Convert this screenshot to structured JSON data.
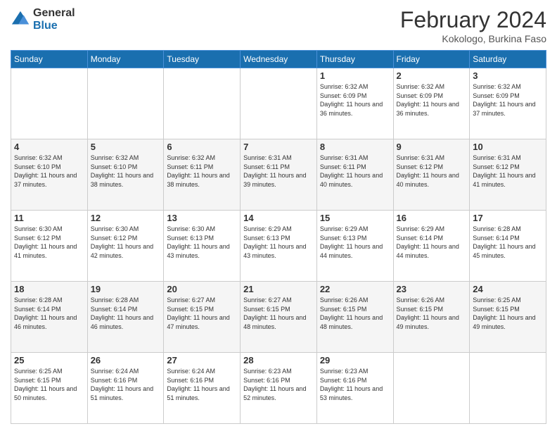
{
  "header": {
    "logo_general": "General",
    "logo_blue": "Blue",
    "month_title": "February 2024",
    "location": "Kokologo, Burkina Faso"
  },
  "weekdays": [
    "Sunday",
    "Monday",
    "Tuesday",
    "Wednesday",
    "Thursday",
    "Friday",
    "Saturday"
  ],
  "weeks": [
    [
      {
        "day": "",
        "info": ""
      },
      {
        "day": "",
        "info": ""
      },
      {
        "day": "",
        "info": ""
      },
      {
        "day": "",
        "info": ""
      },
      {
        "day": "1",
        "info": "Sunrise: 6:32 AM\nSunset: 6:09 PM\nDaylight: 11 hours and 36 minutes."
      },
      {
        "day": "2",
        "info": "Sunrise: 6:32 AM\nSunset: 6:09 PM\nDaylight: 11 hours and 36 minutes."
      },
      {
        "day": "3",
        "info": "Sunrise: 6:32 AM\nSunset: 6:09 PM\nDaylight: 11 hours and 37 minutes."
      }
    ],
    [
      {
        "day": "4",
        "info": "Sunrise: 6:32 AM\nSunset: 6:10 PM\nDaylight: 11 hours and 37 minutes."
      },
      {
        "day": "5",
        "info": "Sunrise: 6:32 AM\nSunset: 6:10 PM\nDaylight: 11 hours and 38 minutes."
      },
      {
        "day": "6",
        "info": "Sunrise: 6:32 AM\nSunset: 6:11 PM\nDaylight: 11 hours and 38 minutes."
      },
      {
        "day": "7",
        "info": "Sunrise: 6:31 AM\nSunset: 6:11 PM\nDaylight: 11 hours and 39 minutes."
      },
      {
        "day": "8",
        "info": "Sunrise: 6:31 AM\nSunset: 6:11 PM\nDaylight: 11 hours and 40 minutes."
      },
      {
        "day": "9",
        "info": "Sunrise: 6:31 AM\nSunset: 6:12 PM\nDaylight: 11 hours and 40 minutes."
      },
      {
        "day": "10",
        "info": "Sunrise: 6:31 AM\nSunset: 6:12 PM\nDaylight: 11 hours and 41 minutes."
      }
    ],
    [
      {
        "day": "11",
        "info": "Sunrise: 6:30 AM\nSunset: 6:12 PM\nDaylight: 11 hours and 41 minutes."
      },
      {
        "day": "12",
        "info": "Sunrise: 6:30 AM\nSunset: 6:12 PM\nDaylight: 11 hours and 42 minutes."
      },
      {
        "day": "13",
        "info": "Sunrise: 6:30 AM\nSunset: 6:13 PM\nDaylight: 11 hours and 43 minutes."
      },
      {
        "day": "14",
        "info": "Sunrise: 6:29 AM\nSunset: 6:13 PM\nDaylight: 11 hours and 43 minutes."
      },
      {
        "day": "15",
        "info": "Sunrise: 6:29 AM\nSunset: 6:13 PM\nDaylight: 11 hours and 44 minutes."
      },
      {
        "day": "16",
        "info": "Sunrise: 6:29 AM\nSunset: 6:14 PM\nDaylight: 11 hours and 44 minutes."
      },
      {
        "day": "17",
        "info": "Sunrise: 6:28 AM\nSunset: 6:14 PM\nDaylight: 11 hours and 45 minutes."
      }
    ],
    [
      {
        "day": "18",
        "info": "Sunrise: 6:28 AM\nSunset: 6:14 PM\nDaylight: 11 hours and 46 minutes."
      },
      {
        "day": "19",
        "info": "Sunrise: 6:28 AM\nSunset: 6:14 PM\nDaylight: 11 hours and 46 minutes."
      },
      {
        "day": "20",
        "info": "Sunrise: 6:27 AM\nSunset: 6:15 PM\nDaylight: 11 hours and 47 minutes."
      },
      {
        "day": "21",
        "info": "Sunrise: 6:27 AM\nSunset: 6:15 PM\nDaylight: 11 hours and 48 minutes."
      },
      {
        "day": "22",
        "info": "Sunrise: 6:26 AM\nSunset: 6:15 PM\nDaylight: 11 hours and 48 minutes."
      },
      {
        "day": "23",
        "info": "Sunrise: 6:26 AM\nSunset: 6:15 PM\nDaylight: 11 hours and 49 minutes."
      },
      {
        "day": "24",
        "info": "Sunrise: 6:25 AM\nSunset: 6:15 PM\nDaylight: 11 hours and 49 minutes."
      }
    ],
    [
      {
        "day": "25",
        "info": "Sunrise: 6:25 AM\nSunset: 6:15 PM\nDaylight: 11 hours and 50 minutes."
      },
      {
        "day": "26",
        "info": "Sunrise: 6:24 AM\nSunset: 6:16 PM\nDaylight: 11 hours and 51 minutes."
      },
      {
        "day": "27",
        "info": "Sunrise: 6:24 AM\nSunset: 6:16 PM\nDaylight: 11 hours and 51 minutes."
      },
      {
        "day": "28",
        "info": "Sunrise: 6:23 AM\nSunset: 6:16 PM\nDaylight: 11 hours and 52 minutes."
      },
      {
        "day": "29",
        "info": "Sunrise: 6:23 AM\nSunset: 6:16 PM\nDaylight: 11 hours and 53 minutes."
      },
      {
        "day": "",
        "info": ""
      },
      {
        "day": "",
        "info": ""
      }
    ]
  ]
}
